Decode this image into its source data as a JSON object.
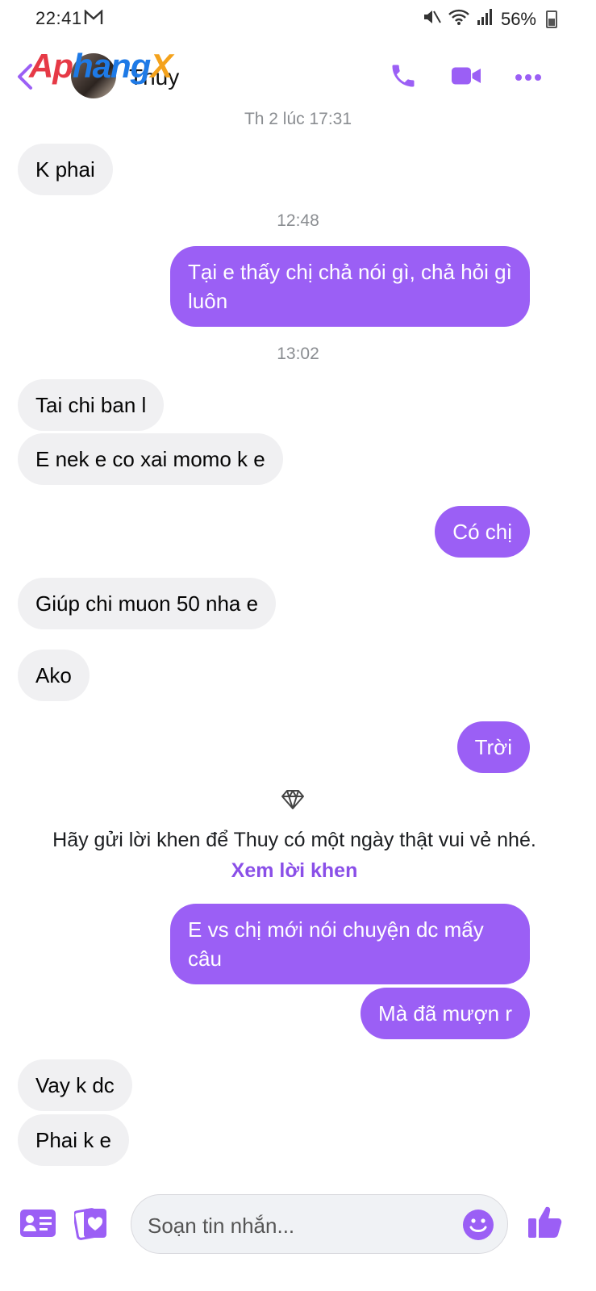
{
  "status_bar": {
    "time": "22:41",
    "battery": "56%"
  },
  "header": {
    "contact_name": "Thuy",
    "watermark": {
      "part1": "Ap",
      "part2": "hang",
      "part3": "X"
    }
  },
  "chat": {
    "timestamps": {
      "t1": "Th 2 lúc 17:31",
      "t2": "12:48",
      "t3": "13:02"
    },
    "messages": [
      {
        "text": "K phai"
      },
      {
        "text": "Tại e thấy chị chả nói gì, chả hỏi gì luôn"
      },
      {
        "text": "Tai chi ban l"
      },
      {
        "text": "E nek e co xai momo k e"
      },
      {
        "text": "Có chị"
      },
      {
        "text": "Giúp chi muon 50 nha e"
      },
      {
        "text": "Ako"
      },
      {
        "text": "Trời"
      },
      {
        "text": "E vs chị mới nói chuyện dc mấy câu"
      },
      {
        "text": "Mà đã mượn r"
      },
      {
        "text": "Vay k dc"
      },
      {
        "text": "Phai k e"
      }
    ],
    "compliment": {
      "text": "Hãy gửi lời khen để Thuy có một ngày thật vui vẻ nhé.",
      "link": "Xem lời khen"
    }
  },
  "composer": {
    "placeholder": "Soạn tin nhắn..."
  },
  "colors": {
    "accent": "#9b5ff5",
    "incoming_bubble": "#f0f0f2"
  }
}
